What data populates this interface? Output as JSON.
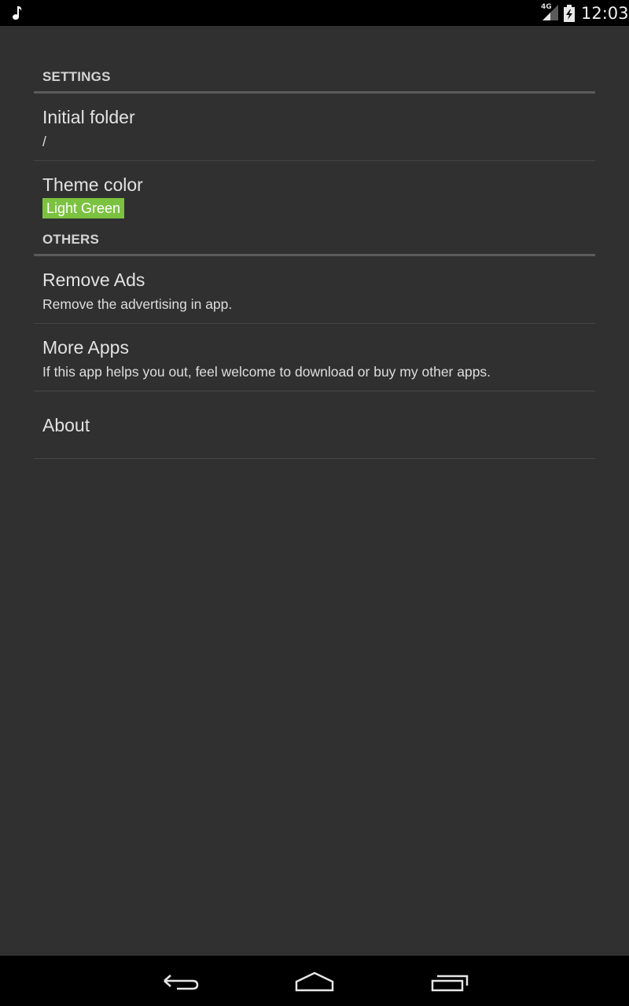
{
  "status_bar": {
    "network": "4G",
    "time": "12:03"
  },
  "sections": {
    "settings": {
      "header": "SETTINGS",
      "items": [
        {
          "title": "Initial folder",
          "summary": "/"
        },
        {
          "title": "Theme color",
          "summary": "Light Green",
          "badge_color": "#7cc241"
        }
      ]
    },
    "others": {
      "header": "OTHERS",
      "items": [
        {
          "title": "Remove Ads",
          "summary": "Remove the advertising in app."
        },
        {
          "title": "More Apps",
          "summary": "If this app helps you out, feel welcome to download or buy my other apps."
        },
        {
          "title": "About"
        }
      ]
    }
  },
  "icons": {
    "status_left": "music-note-icon",
    "signal": "signal-icon",
    "battery": "battery-charging-icon",
    "nav_back": "back-icon",
    "nav_home": "home-icon",
    "nav_recents": "recents-icon"
  }
}
